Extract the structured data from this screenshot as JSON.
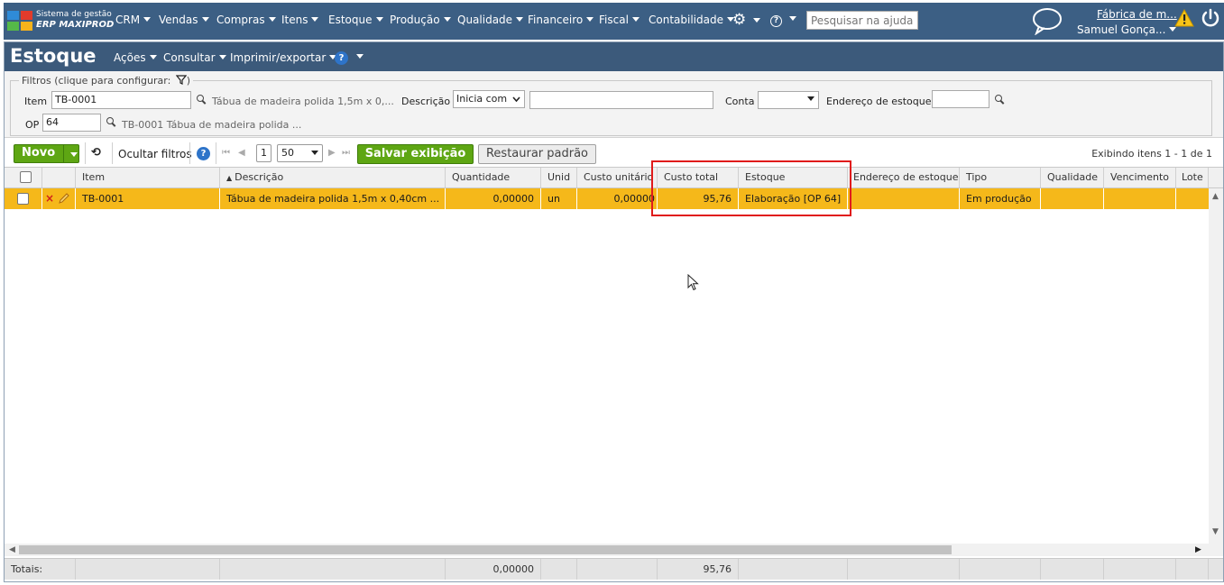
{
  "app": {
    "brand_line1": "Sistema de gestão",
    "brand_line2": "ERP MAXIPROD",
    "menus": [
      "CRM",
      "Vendas",
      "Compras",
      "Itens",
      "Estoque",
      "Produção",
      "Qualidade",
      "Financeiro",
      "Fiscal",
      "Contabilidade"
    ],
    "help_search_placeholder": "Pesquisar na ajuda...",
    "company": "Fábrica de m...",
    "user": "Samuel Gonça..."
  },
  "page": {
    "title": "Estoque",
    "menus": [
      "Ações",
      "Consultar",
      "Imprimir/exportar"
    ]
  },
  "filters": {
    "legend": "Filtros (clique para configurar:",
    "item_label": "Item",
    "item_value": "TB-0001",
    "item_hint": "Tábua de madeira polida 1,5m x 0,...",
    "descricao_label": "Descrição",
    "descricao_mode": "Inicia com",
    "descricao_value": "",
    "conta_label": "Conta",
    "conta_value": "",
    "endereco_label": "Endereço de estoque",
    "endereco_value": "",
    "op_label": "OP",
    "op_value": "64",
    "op_hint": "TB-0001 Tábua de madeira polida ..."
  },
  "toolbar": {
    "new_label": "Novo",
    "hide_filters_label": "Ocultar filtros",
    "page_number": "1",
    "page_size": "50",
    "save_view_label": "Salvar exibição",
    "restore_label": "Restaurar padrão",
    "count_text": "Exibindo itens 1 - 1 de 1"
  },
  "grid": {
    "columns": [
      "Item",
      "Descrição",
      "Quantidade",
      "Unid",
      "Custo unitário",
      "Custo total",
      "Estoque",
      "Endereço de estoque",
      "Tipo",
      "Qualidade",
      "Vencimento",
      "Lote"
    ],
    "rows": [
      {
        "item": "TB-0001",
        "descricao": "Tábua de madeira polida 1,5m x 0,40cm ...",
        "quantidade": "0,00000",
        "unid": "un",
        "custo_unitario": "0,00000",
        "custo_total": "95,76",
        "estoque": "Elaboração [OP 64]",
        "endereco": "",
        "tipo": "Em produção",
        "qualidade": "",
        "vencimento": "",
        "lote": ""
      }
    ],
    "totals": {
      "label": "Totais:",
      "quantidade": "0,00000",
      "custo_total": "95,76"
    }
  },
  "colors": {
    "topbar": "#3c5f84",
    "title_bar": "#3c5a7b",
    "selected_row": "#f5b81a",
    "primary_button": "#5ea613",
    "highlight_box": "#e01b1b"
  }
}
